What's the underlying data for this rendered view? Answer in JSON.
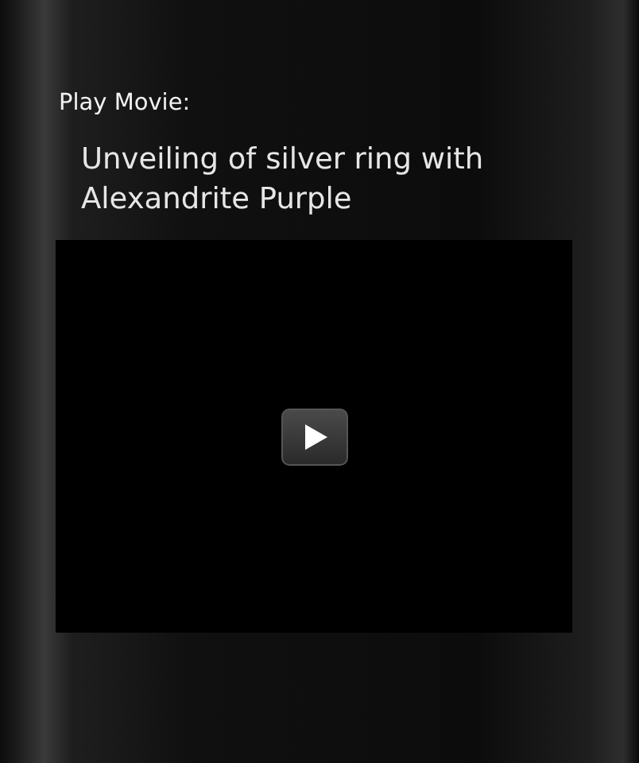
{
  "heading": "Play Movie:",
  "video": {
    "title": "Unveiling of silver ring with Alexandrite Purple"
  }
}
